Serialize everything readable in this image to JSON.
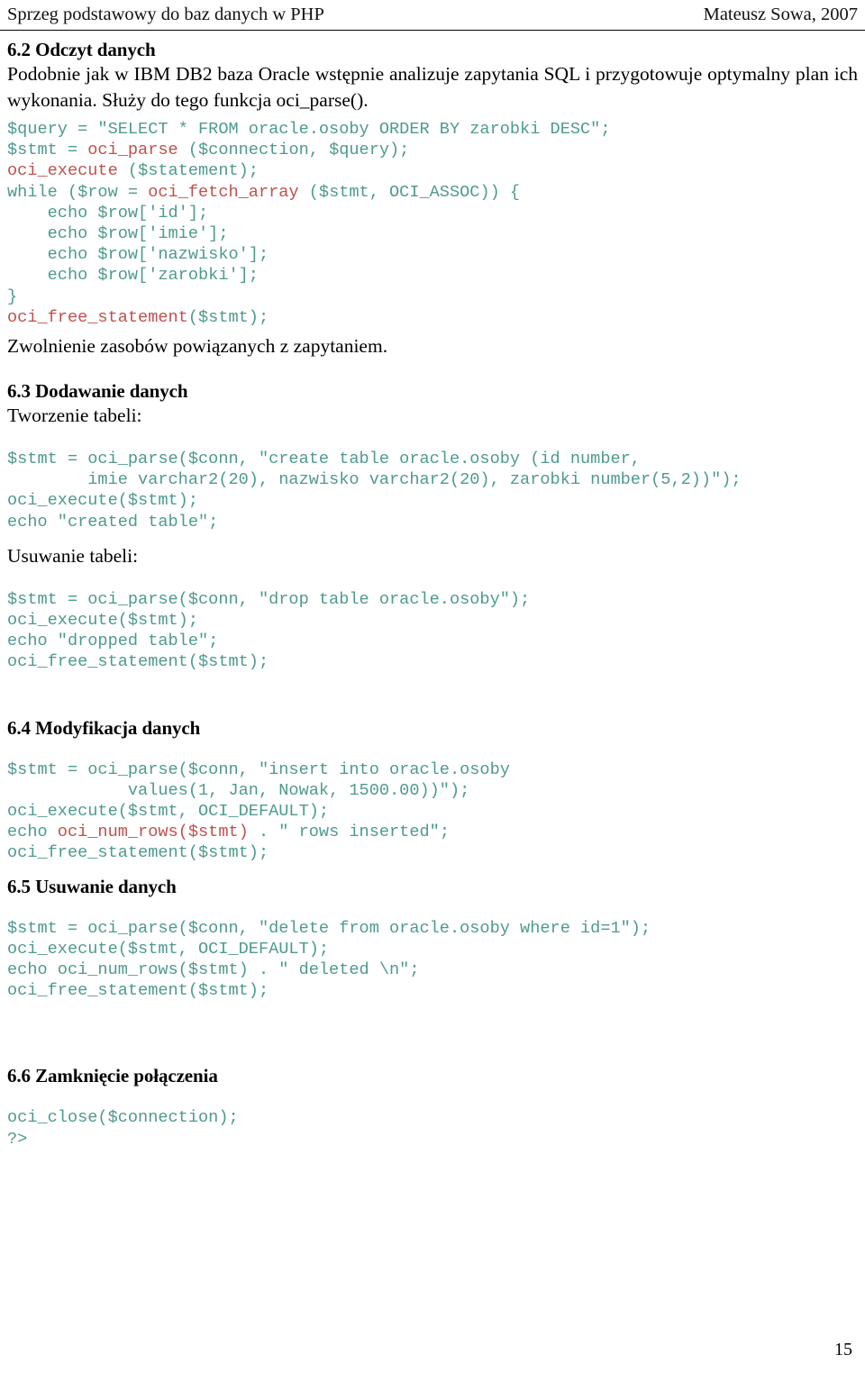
{
  "header": {
    "left_title": "Sprzeg podstawowy do baz danych w PHP",
    "right_title": "Mateusz Sowa, 2007"
  },
  "footer": {
    "page_number": "15"
  },
  "colors": {
    "code_default": "#4e9a8f",
    "code_function": "#c0504d",
    "text": "#000000"
  },
  "sections": {
    "s62": {
      "heading": "6.2 Odczyt danych",
      "paragraph": "Podobnie jak w IBM DB2 baza Oracle wstępnie analizuje zapytania SQL i przygotowuje optymalny plan ich wykonania. Służy do tego funkcja oci_parse().",
      "code": {
        "l1": "$query = \"SELECT * FROM oracle.osoby ORDER BY zarobki DESC\";",
        "l2a": "$stmt = ",
        "l2b": "oci_parse",
        "l2c": " ($connection, $query);",
        "l3a": "oci_execute",
        "l3b": " ($statement);",
        "l4": "",
        "l5a": "while ($row = ",
        "l5b": "oci_fetch_array",
        "l5c": " ($stmt, OCI_ASSOC)) {",
        "l6": "    echo $row['id'];",
        "l7": "    echo $row['imie'];",
        "l8": "    echo $row['nazwisko'];",
        "l9": "    echo $row['zarobki'];",
        "l10": "}",
        "l11a": "oci_free_statement",
        "l11b": "($stmt);"
      },
      "caption": "Zwolnienie zasobów powiązanych z zapytaniem."
    },
    "s63": {
      "heading": "6.3 Dodawanie danych",
      "label_create": "Tworzenie tabeli:",
      "code_create": {
        "l1": "$stmt = oci_parse($conn, \"create table oracle.osoby (id number,",
        "l2": "        imie varchar2(20), nazwisko varchar2(20), zarobki number(5,2))\");",
        "l3": "oci_execute($stmt);",
        "l4": "echo \"created table\";"
      },
      "label_drop": "Usuwanie tabeli:",
      "code_drop": {
        "l1": "$stmt = oci_parse($conn, \"drop table oracle.osoby\");",
        "l2": "oci_execute($stmt);",
        "l3": "echo \"dropped table\";",
        "l4": "oci_free_statement($stmt);"
      }
    },
    "s64": {
      "heading": "6.4 Modyfikacja danych",
      "code": {
        "l1": "$stmt = oci_parse($conn, \"insert into oracle.osoby",
        "l2": "            values(1, Jan, Nowak, 1500.00))\");",
        "l3": "oci_execute($stmt, OCI_DEFAULT);",
        "l4a": "echo ",
        "l4b": "oci_num_rows($stmt)",
        "l4c": " . \" rows inserted\";",
        "l5": "oci_free_statement($stmt);"
      }
    },
    "s65": {
      "heading": "6.5 Usuwanie danych",
      "code": {
        "l1": "$stmt = oci_parse($conn, \"delete from oracle.osoby where id=1\");",
        "l2": "oci_execute($stmt, OCI_DEFAULT);",
        "l3": "echo oci_num_rows($stmt) . \" deleted \\n\";",
        "l4": "oci_free_statement($stmt);"
      }
    },
    "s66": {
      "heading": "6.6 Zamknięcie połączenia",
      "code": {
        "l1": "oci_close($connection);",
        "l2": "?>"
      }
    }
  }
}
